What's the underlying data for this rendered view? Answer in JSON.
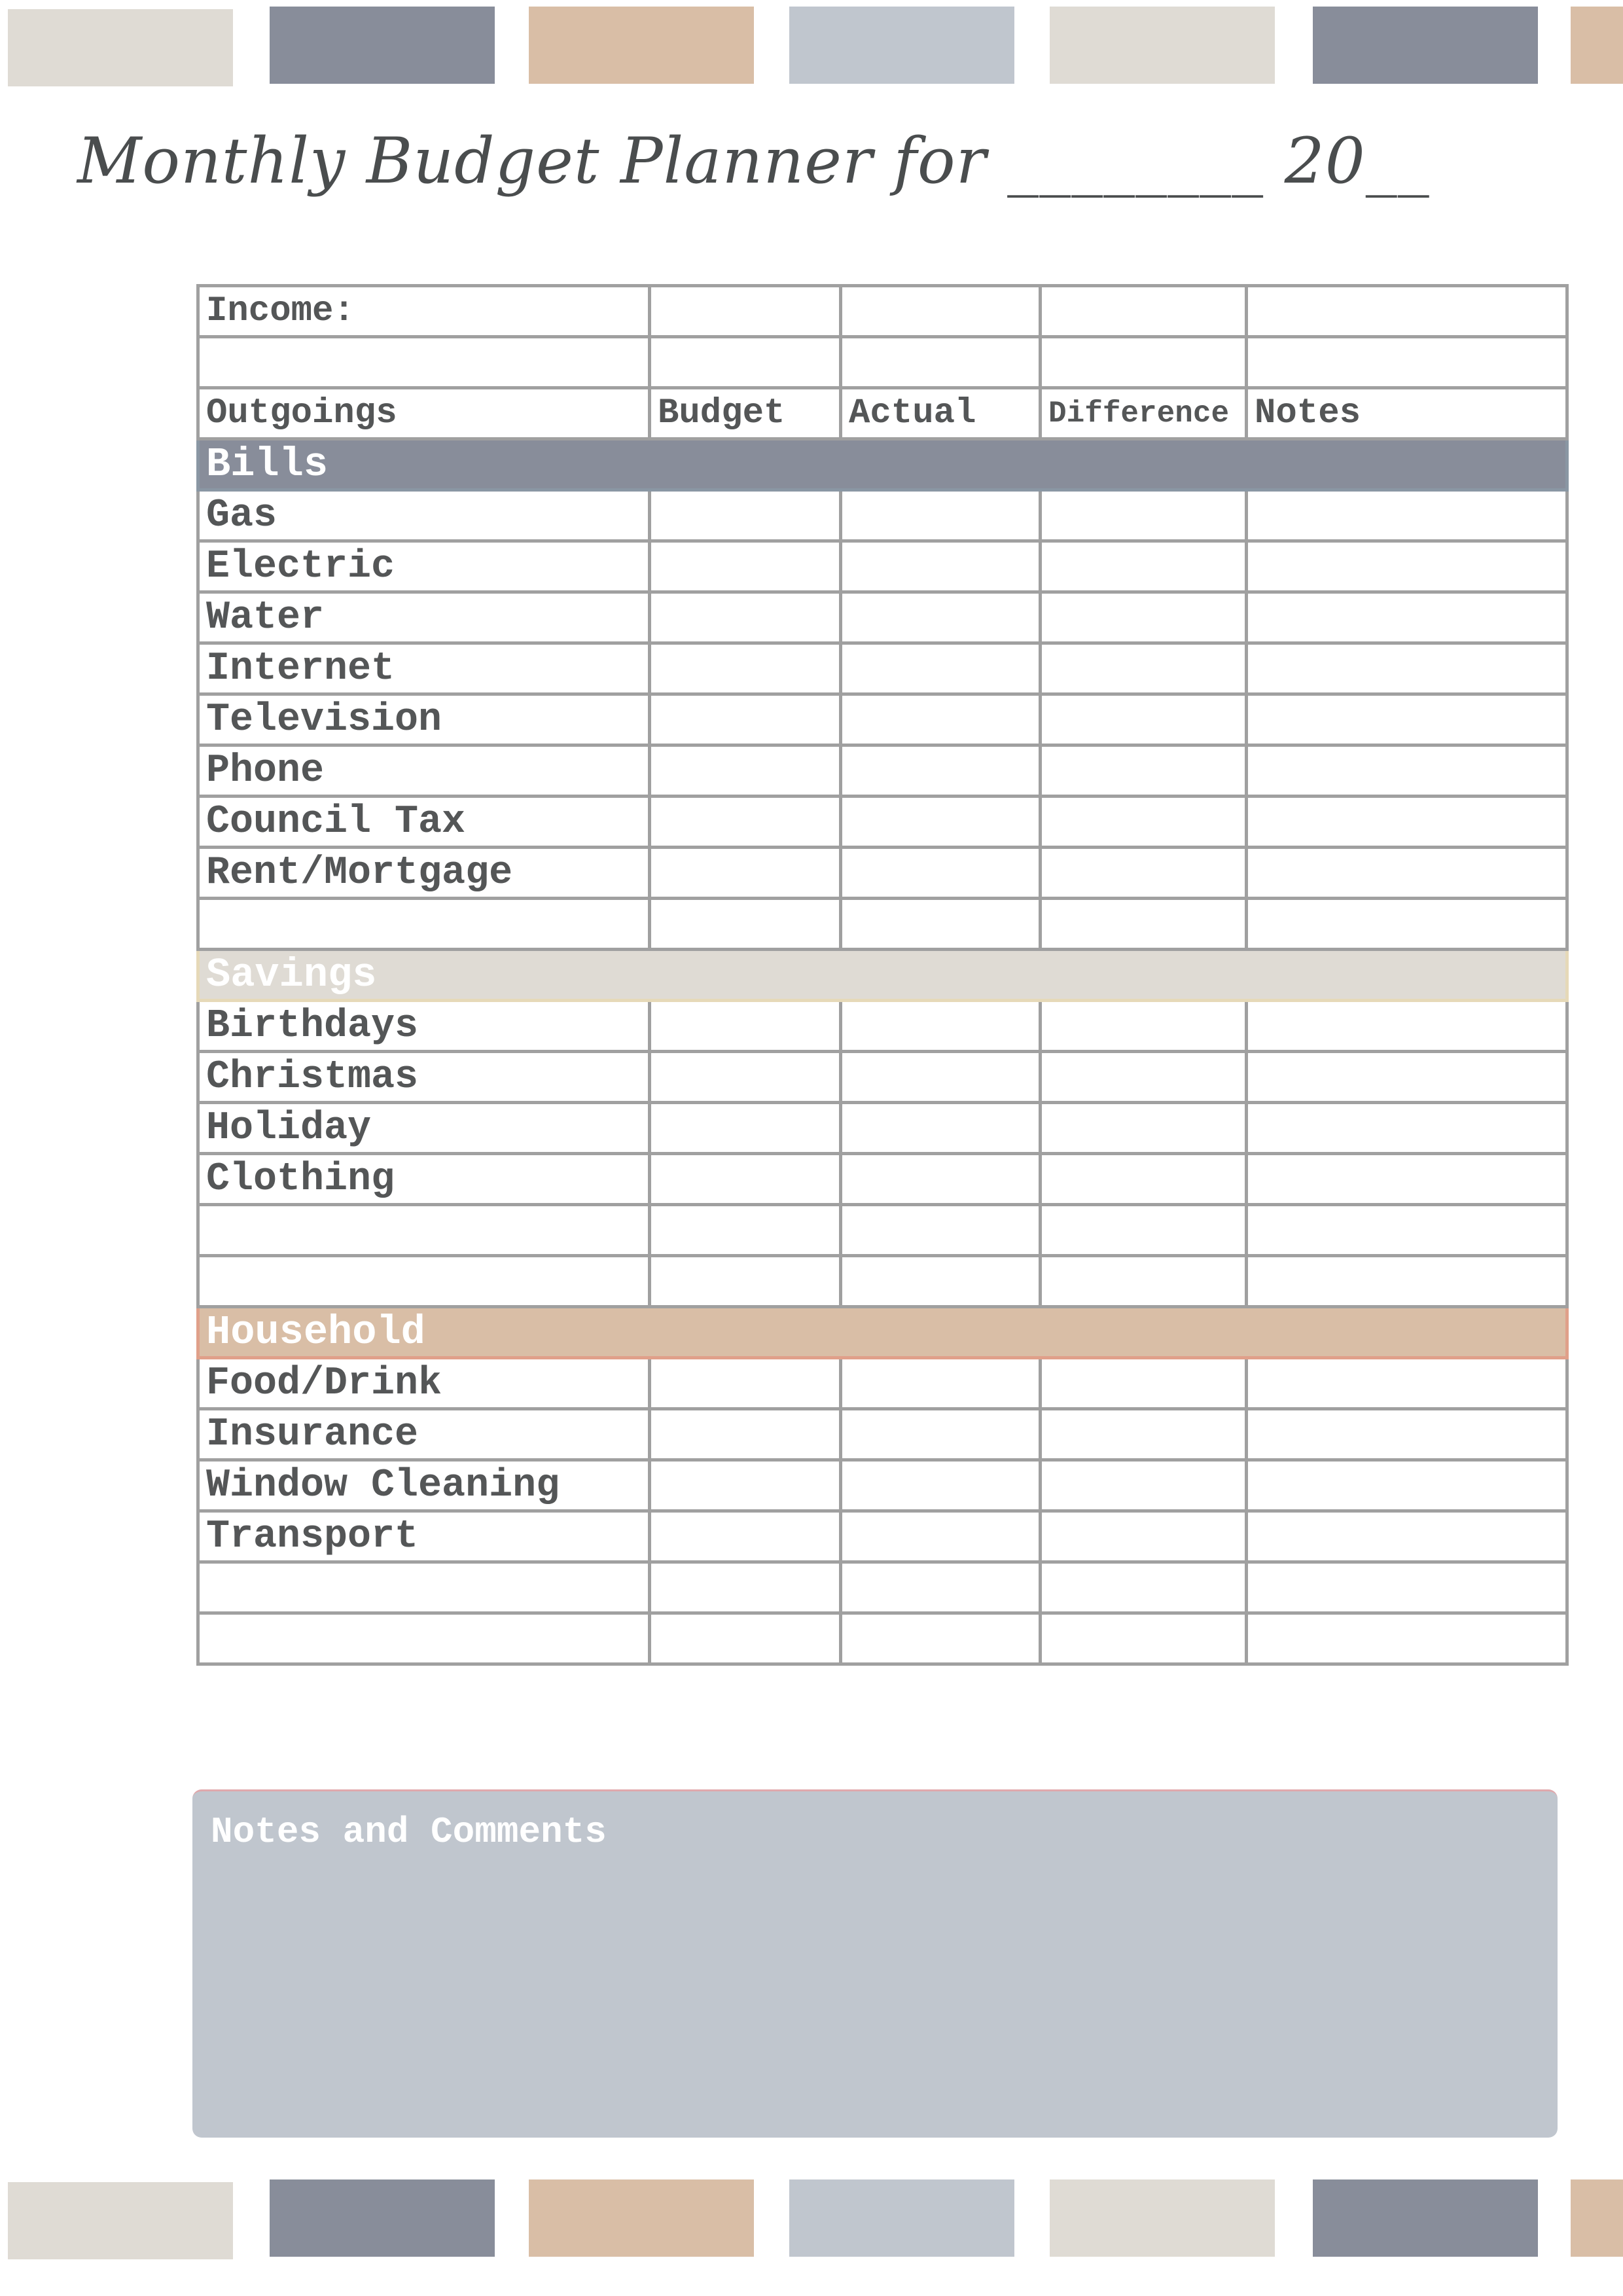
{
  "palette": {
    "beige": "#dfdbd4",
    "slate": "#888d9a",
    "tan": "#d9bea6",
    "light_blue_gray": "#c0c6ce"
  },
  "swatches_top": [
    "beige",
    "slate",
    "tan",
    "light_blue_gray",
    "beige",
    "slate",
    "tan"
  ],
  "swatches_bottom": [
    "beige",
    "slate",
    "tan",
    "light_blue_gray",
    "beige",
    "slate",
    "tan"
  ],
  "title": "Monthly Budget Planner for ________ 20__",
  "table": {
    "income_label": "Income:",
    "headers": {
      "outgoings": "Outgoings",
      "budget": "Budget",
      "actual": "Actual",
      "difference": "Difference",
      "notes": "Notes"
    },
    "sections": {
      "bills": {
        "label": "Bills",
        "items": [
          "Gas",
          "Electric",
          "Water",
          "Internet",
          "Television",
          "Phone",
          "Council Tax",
          "Rent/Mortgage",
          ""
        ]
      },
      "savings": {
        "label": "Savings",
        "items": [
          "Birthdays",
          "Christmas",
          "Holiday",
          "Clothing",
          "",
          ""
        ]
      },
      "household": {
        "label": "Household",
        "items": [
          "Food/Drink",
          "Insurance",
          "Window Cleaning",
          "Transport",
          "",
          ""
        ]
      }
    }
  },
  "notes": {
    "label": "Notes and Comments"
  }
}
